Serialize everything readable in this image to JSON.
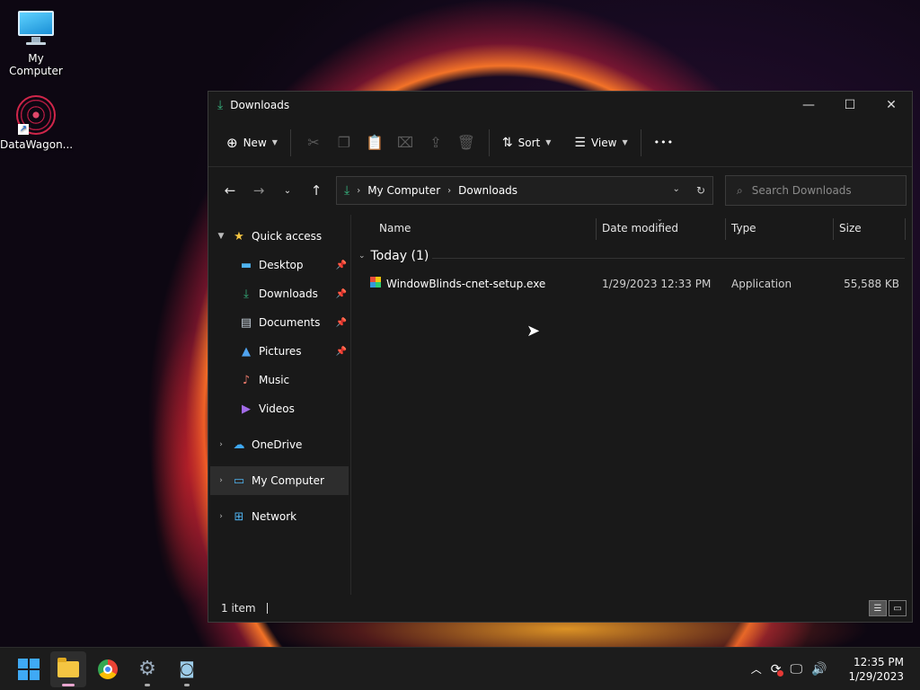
{
  "desktop": {
    "icons": [
      {
        "label": "My Computer"
      },
      {
        "label": "DataWagon..."
      }
    ]
  },
  "window": {
    "title": "Downloads",
    "controls": {
      "minimize": "—",
      "maximize": "☐",
      "close": "✕"
    }
  },
  "toolbar": {
    "new_label": "New",
    "sort_label": "Sort",
    "view_label": "View",
    "more_label": "•••"
  },
  "address": {
    "crumbs": [
      "My Computer",
      "Downloads"
    ]
  },
  "search": {
    "placeholder": "Search Downloads"
  },
  "navpane": {
    "quick_access": "Quick access",
    "items": [
      {
        "label": "Desktop"
      },
      {
        "label": "Downloads"
      },
      {
        "label": "Documents"
      },
      {
        "label": "Pictures"
      },
      {
        "label": "Music"
      },
      {
        "label": "Videos"
      }
    ],
    "onedrive": "OneDrive",
    "my_computer": "My Computer",
    "network": "Network"
  },
  "columns": {
    "name": "Name",
    "date": "Date modified",
    "type": "Type",
    "size": "Size"
  },
  "group": {
    "label": "Today (1)"
  },
  "files": [
    {
      "name": "WindowBlinds-cnet-setup.exe",
      "date": "1/29/2023 12:33 PM",
      "type": "Application",
      "size": "55,588 KB"
    }
  ],
  "status": {
    "count": "1 item"
  },
  "taskbar": {
    "time": "12:35 PM",
    "date": "1/29/2023"
  },
  "colors": {
    "accent": "#3fa9f5",
    "window_bg": "#191919",
    "taskbar_bg": "#1c1c1c"
  }
}
